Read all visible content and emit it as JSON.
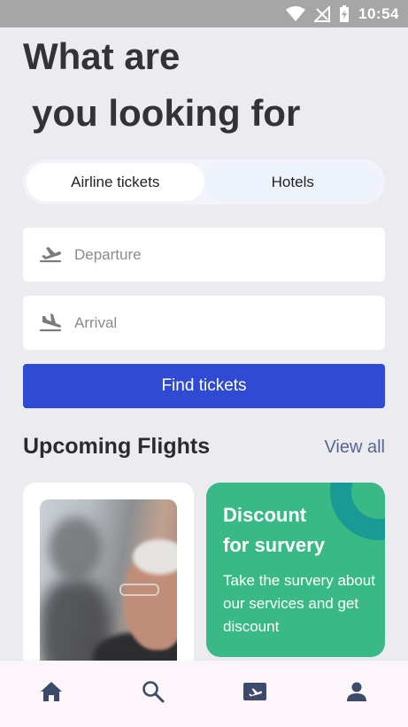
{
  "status_bar": {
    "time": "10:54"
  },
  "headline": {
    "line1": "What are",
    "line2": "you looking for"
  },
  "segment": {
    "tab1": "Airline tickets",
    "tab2": "Hotels",
    "active": "tab1"
  },
  "search": {
    "departure_placeholder": "Departure",
    "arrival_placeholder": "Arrival",
    "find_button": "Find tickets"
  },
  "upcoming": {
    "title": "Upcoming Flights",
    "view_all": "View all"
  },
  "promo": {
    "title_line1": "Discount",
    "title_line2": "for survery",
    "body": "Take the survery about our services and get discount"
  },
  "bottom_nav": {
    "items": [
      "home-icon",
      "search-icon",
      "ticket-icon",
      "profile-icon"
    ]
  },
  "colors": {
    "primary": "#2f4bd3",
    "promo_green": "#39b985",
    "promo_ring": "#1a9a94",
    "link": "#56688f",
    "nav_icon": "#3c4a6b"
  }
}
